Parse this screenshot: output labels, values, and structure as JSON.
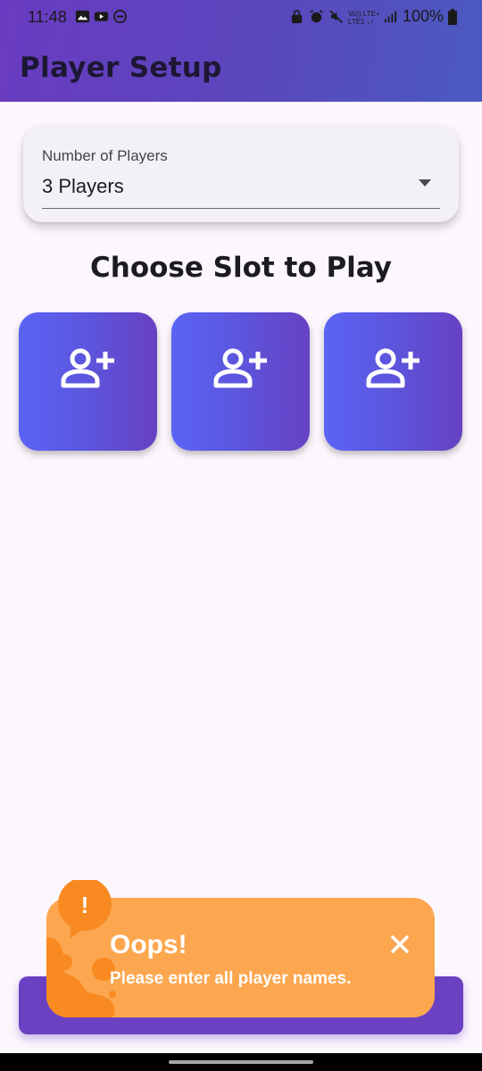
{
  "status_bar": {
    "time": "11:48",
    "battery": "100%",
    "left_icons": [
      "image-icon",
      "youtube-icon",
      "dnd-icon"
    ],
    "right_icons": [
      "lock-icon",
      "alarm-icon",
      "mute-icon",
      "volte-icon",
      "signal-icon",
      "battery-icon"
    ]
  },
  "app_bar": {
    "title": "Player Setup"
  },
  "players_dropdown": {
    "label": "Number of Players",
    "selected": "3 Players"
  },
  "section": {
    "title": "Choose Slot to Play"
  },
  "slots": [
    {
      "icon": "add-person-icon"
    },
    {
      "icon": "add-person-icon"
    },
    {
      "icon": "add-person-icon"
    }
  ],
  "toast": {
    "title": "Oops!",
    "message": "Please enter all player names.",
    "badge": "!"
  },
  "colors": {
    "app_bar_gradient_start": "#6a3bc0",
    "app_bar_gradient_end": "#4b5ac0",
    "slot_gradient_start": "#5a64f5",
    "slot_gradient_end": "#6741c2",
    "toast_bg": "#fca74f",
    "toast_accent": "#f88a21",
    "bottom_button": "#6b41c2"
  }
}
